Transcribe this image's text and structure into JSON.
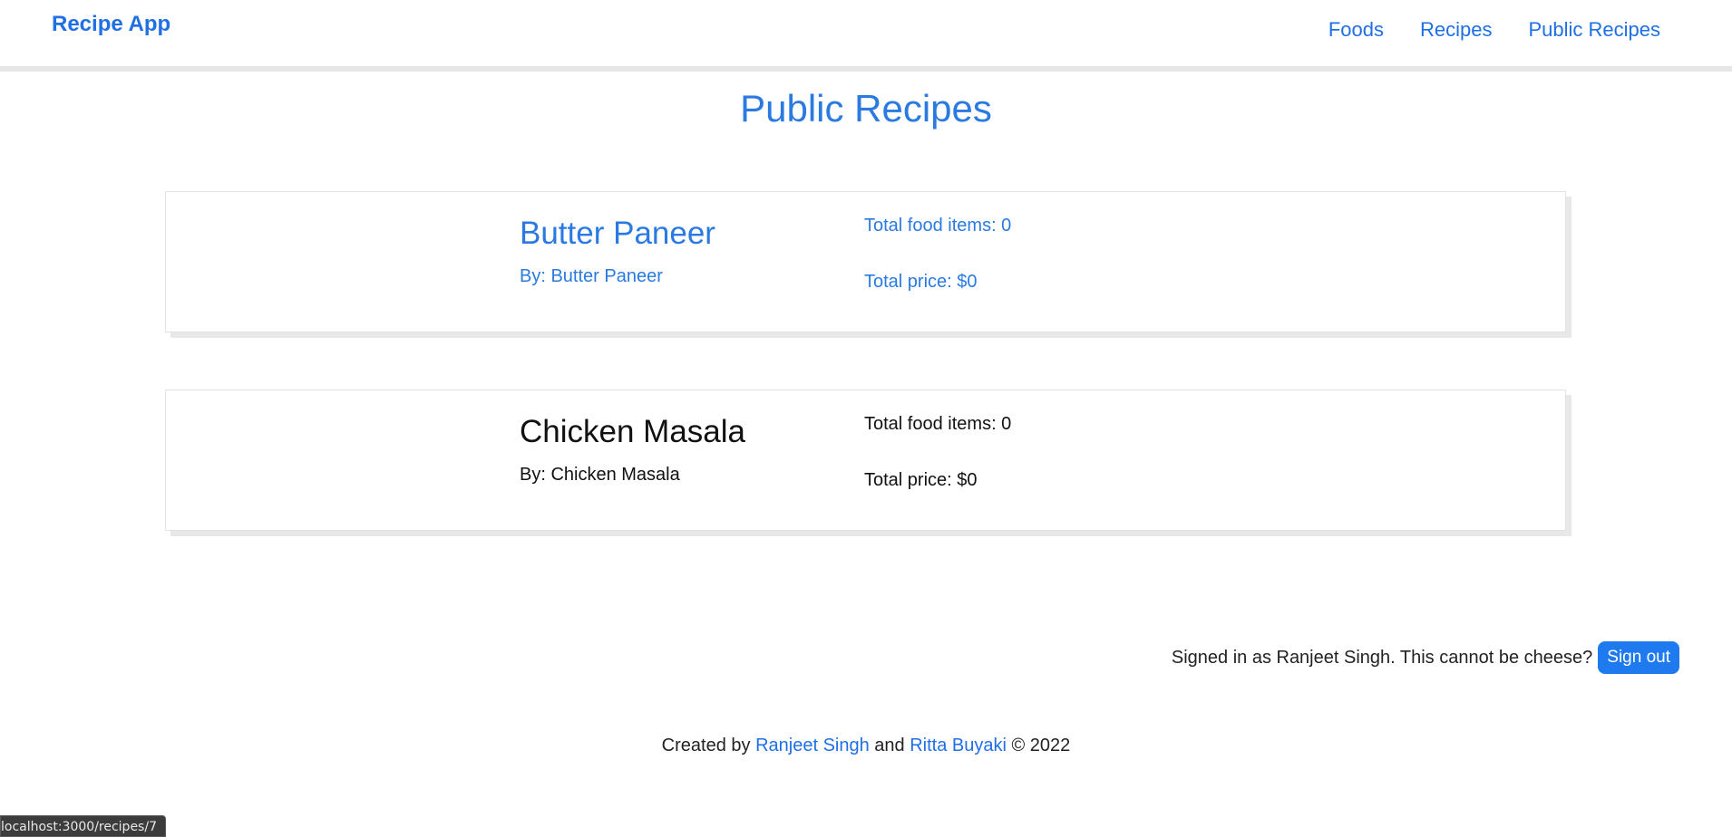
{
  "navbar": {
    "brand": "Recipe App",
    "links": [
      "Foods",
      "Recipes",
      "Public Recipes"
    ]
  },
  "page": {
    "title": "Public Recipes"
  },
  "recipes": [
    {
      "name": "Butter Paneer",
      "author": "By: Butter Paneer",
      "total_items": "Total food items: 0",
      "total_price": "Total price: $0"
    },
    {
      "name": "Chicken Masala",
      "author": "By: Chicken Masala",
      "total_items": "Total food items: 0",
      "total_price": "Total price: $0"
    }
  ],
  "session": {
    "signed_in_text": "Signed in as Ranjeet Singh. This cannot be cheese?",
    "signout_label": "Sign out"
  },
  "footer": {
    "created_by": "Created by",
    "author1": "Ranjeet Singh",
    "and": "and",
    "author2": "Ritta Buyaki",
    "copyright": "© 2022"
  },
  "status_bar": {
    "url": "localhost:3000/recipes/7"
  },
  "colors": {
    "accent": "#1f6fe5",
    "button": "#1f7aef",
    "text": "#111111"
  }
}
